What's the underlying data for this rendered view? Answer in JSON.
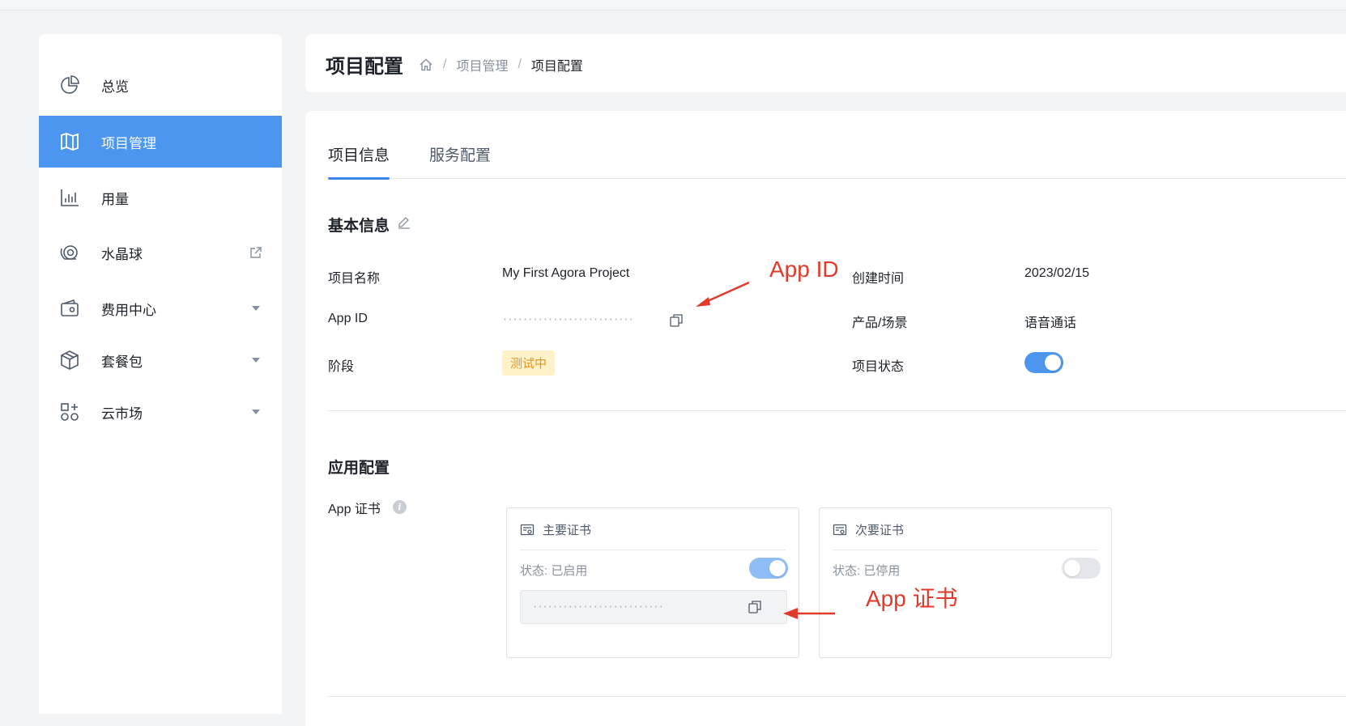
{
  "sidebar": {
    "items": [
      {
        "label": "总览",
        "icon": "pie-chart-icon"
      },
      {
        "label": "项目管理",
        "icon": "map-icon",
        "active": true
      },
      {
        "label": "用量",
        "icon": "bar-chart-icon"
      },
      {
        "label": "水晶球",
        "icon": "crystal-ball-icon",
        "trail_icon": "external-link-icon"
      },
      {
        "label": "费用中心",
        "icon": "wallet-icon",
        "trail_icon": "caret-down-icon"
      },
      {
        "label": "套餐包",
        "icon": "package-icon",
        "trail_icon": "caret-down-icon"
      },
      {
        "label": "云市场",
        "icon": "marketplace-icon",
        "trail_icon": "caret-down-icon"
      }
    ]
  },
  "header": {
    "title": "项目配置",
    "breadcrumb": {
      "home_icon": "home-icon",
      "separator": "/",
      "level1": "项目管理",
      "current": "项目配置"
    }
  },
  "tabs": [
    {
      "label": "项目信息",
      "active": true
    },
    {
      "label": "服务配置",
      "active": false
    }
  ],
  "basic_info": {
    "title": "基本信息",
    "project_name_label": "项目名称",
    "project_name_value": "My First Agora Project",
    "app_id_label": "App ID",
    "app_id_value": "································",
    "stage_label": "阶段",
    "stage_value": "测试中",
    "created_label": "创建时间",
    "created_value": "2023/02/15",
    "scene_label": "产品/场景",
    "scene_value": "语音通话",
    "status_label": "项目状态",
    "status_enabled": true
  },
  "app_config": {
    "title": "应用配置",
    "cert_label": "App 证书",
    "primary": {
      "title": "主要证书",
      "status": "状态: 已启用",
      "enabled": true,
      "secret": "································"
    },
    "secondary": {
      "title": "次要证书",
      "status": "状态: 已停用",
      "enabled": false
    }
  },
  "annotations": {
    "app_id": "App ID",
    "app_cert": "App 证书"
  },
  "colors": {
    "accent": "#4c96ef",
    "annotation": "#e23a2a",
    "tag_bg": "#fff1c9",
    "tag_text": "#e0961f"
  }
}
